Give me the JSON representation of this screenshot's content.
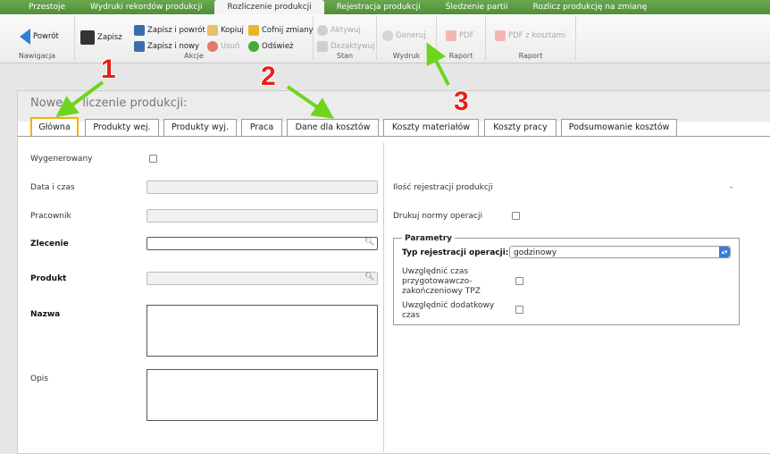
{
  "topnav": [
    "Przestoje",
    "Wydruki rekordów produkcji",
    "Rozliczenie produkcji",
    "Rejestracja produkcji",
    "Śledzenie partii",
    "Rozlicz produkcję na zmianę"
  ],
  "ribbon": {
    "nawigacja": {
      "title": "Nawigacja",
      "back": "Powrót"
    },
    "akcje": {
      "title": "Akcje",
      "save": "Zapisz",
      "save_back": "Zapisz i powrót",
      "save_new": "Zapisz i nowy",
      "copy": "Kopiuj",
      "delete": "Usuń",
      "undo": "Cofnij zmiany",
      "refresh": "Odśwież"
    },
    "stan": {
      "title": "Stan",
      "activate": "Aktywuj",
      "deactivate": "Dezaktywuj"
    },
    "wydruk": {
      "title": "Wydruk",
      "generate": "Generuj"
    },
    "raport1": {
      "title": "Raport",
      "pdf": "PDF"
    },
    "raport2": {
      "title": "Raport",
      "pdf_costs": "PDF z kosztami"
    }
  },
  "annotations": [
    "1",
    "2",
    "3"
  ],
  "panel": {
    "title_left": "Nowe",
    "title_right": "liczenie produkcji:",
    "tabs": [
      "Główna",
      "Produkty wej.",
      "Produkty wyj.",
      "Praca",
      "Dane dla kosztów",
      "Koszty materiałów",
      "Koszty pracy",
      "Podsumowanie kosztów"
    ]
  },
  "form": {
    "generated": "Wygenerowany",
    "datetime": "Data i czas",
    "worker": "Pracownik",
    "order": "Zlecenie",
    "product": "Produkt",
    "name": "Nazwa",
    "desc": "Opis",
    "reg_count": "Ilość rejestracji produkcji",
    "reg_count_value": "-",
    "print_norms": "Drukuj normy operacji",
    "params": "Parametry",
    "reg_type": "Typ rejestracji operacji:",
    "reg_type_value": "godzinowy",
    "tpz": "Uwzględnić czas przygotowawczo-zakończeniowy TPZ",
    "extra_time": "Uwzględnić dodatkowy czas"
  },
  "colors": {
    "nav_green": "#5a9a40",
    "annotation_red": "#e8201a",
    "arrow_green": "#6fd41e",
    "active_tab_border": "#f0b400"
  }
}
